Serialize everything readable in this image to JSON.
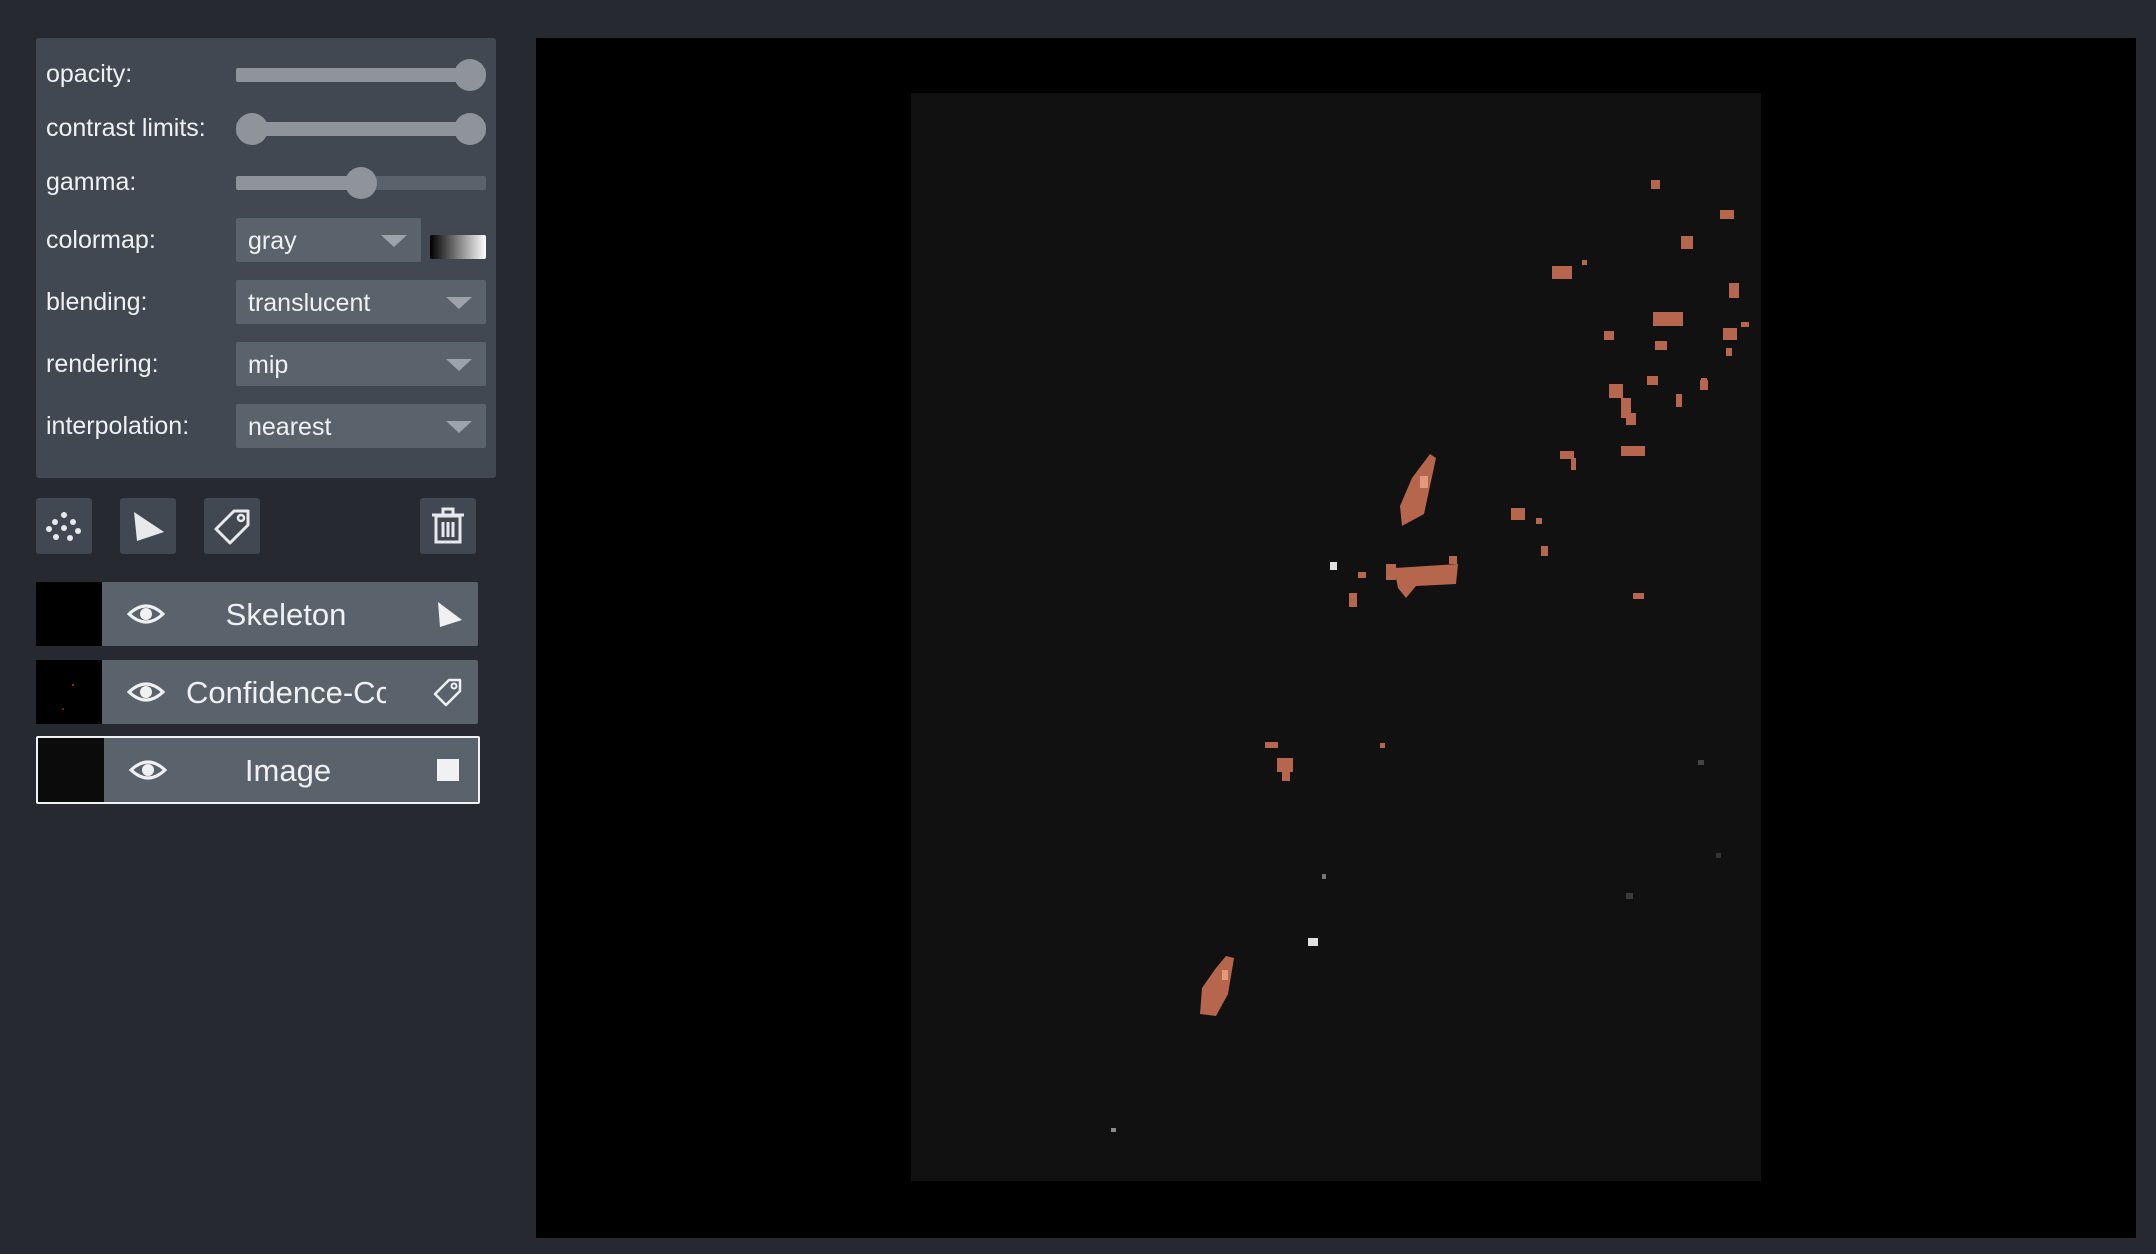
{
  "layer_controls": {
    "opacity": {
      "label": "opacity:",
      "value": 1.0
    },
    "contrast_limits": {
      "label": "contrast limits:",
      "low": 0.0,
      "high": 1.0
    },
    "gamma": {
      "label": "gamma:",
      "value": 0.5
    },
    "colormap": {
      "label": "colormap:",
      "value": "gray"
    },
    "blending": {
      "label": "blending:",
      "value": "translucent"
    },
    "rendering": {
      "label": "rendering:",
      "value": "mip"
    },
    "interpolation": {
      "label": "interpolation:",
      "value": "nearest"
    }
  },
  "layer_buttons": {
    "new_points": "new-points-icon",
    "new_shapes": "new-shapes-icon",
    "new_labels": "new-labels-icon",
    "delete": "trash-icon"
  },
  "layers": [
    {
      "name": "Skeleton",
      "type_icon": "shapes-icon",
      "visible": true,
      "selected": false
    },
    {
      "name": "Confidence-Cc",
      "type_icon": "labels-icon",
      "visible": true,
      "selected": false
    },
    {
      "name": "Image",
      "type_icon": "image-icon",
      "visible": true,
      "selected": true
    }
  ],
  "colors": {
    "panel_bg": "#262930",
    "control_bg": "#414851",
    "widget_bg": "#5a626c",
    "text": "#f0f1f2",
    "label_overlay": "#b5664c"
  }
}
